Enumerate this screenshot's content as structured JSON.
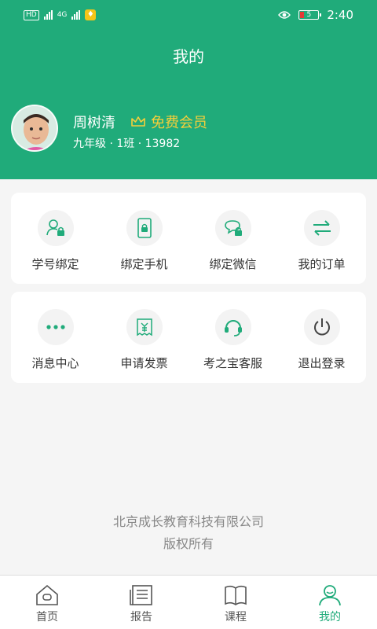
{
  "status_bar": {
    "left_chips": [
      "HD",
      "4G"
    ],
    "time": "2:40",
    "battery_level": "5"
  },
  "header": {
    "title": "我的"
  },
  "user": {
    "name": "周树清",
    "membership": "免费会员",
    "info": "九年级 · 1班 · 13982"
  },
  "menu_row1": [
    {
      "label": "学号绑定",
      "icon": "user-lock-icon"
    },
    {
      "label": "绑定手机",
      "icon": "phone-lock-icon"
    },
    {
      "label": "绑定微信",
      "icon": "chat-lock-icon"
    },
    {
      "label": "我的订单",
      "icon": "swap-arrows-icon"
    }
  ],
  "menu_row2": [
    {
      "label": "消息中心",
      "icon": "dots-icon"
    },
    {
      "label": "申请发票",
      "icon": "invoice-icon"
    },
    {
      "label": "考之宝客服",
      "icon": "headset-icon"
    },
    {
      "label": "退出登录",
      "icon": "power-icon"
    }
  ],
  "footer": {
    "company": "北京成长教育科技有限公司",
    "rights": "版权所有"
  },
  "bottom_nav": [
    {
      "label": "首页",
      "icon": "home-icon"
    },
    {
      "label": "报告",
      "icon": "report-icon"
    },
    {
      "label": "课程",
      "icon": "book-icon"
    },
    {
      "label": "我的",
      "icon": "profile-icon",
      "active": true
    }
  ],
  "colors": {
    "brand": "#20ab7a",
    "vip": "#f6cf3a",
    "background": "#f5f5f5"
  }
}
